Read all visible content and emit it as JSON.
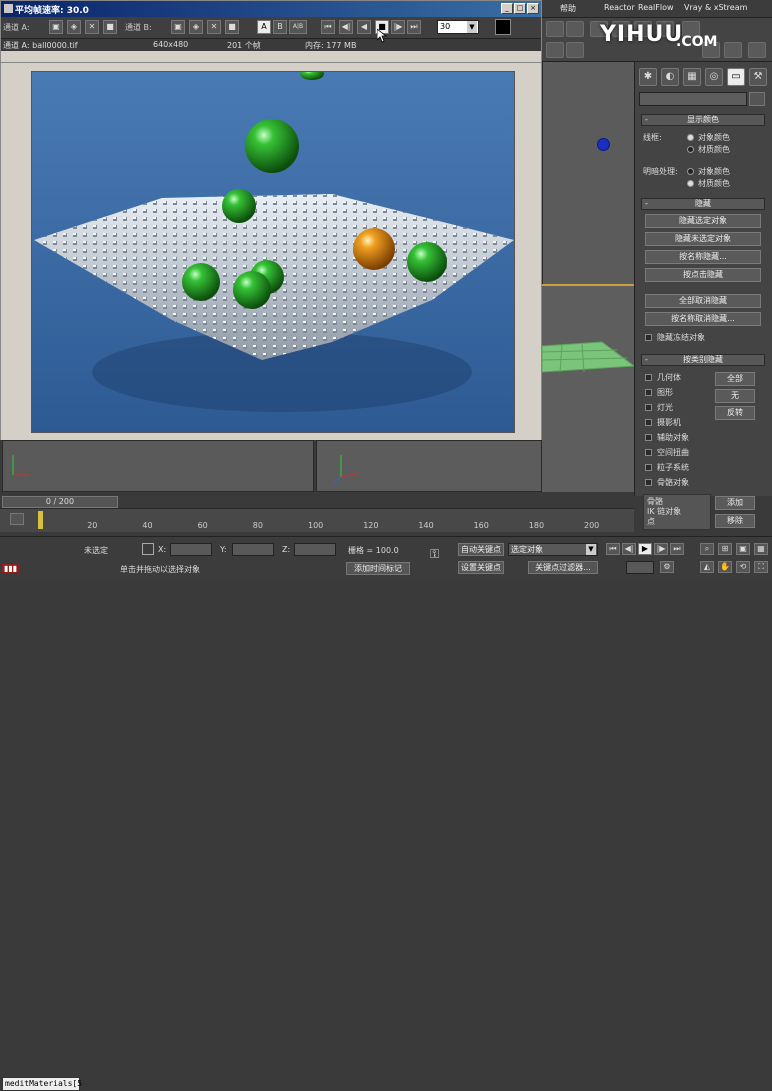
{
  "frame_buffer": {
    "title": "平均帧速率: 30.0",
    "channel_a_label": "通道 A:",
    "channel_b_label": "通道 B:",
    "frame_input_value": "30",
    "info": {
      "channel": "通道 A: ball0000.tif",
      "resolution": "640x480",
      "frame": "201 个帧",
      "memory": "内存: 177 MB"
    },
    "toolbar_letters": [
      "A",
      "B",
      "A|B"
    ]
  },
  "menubar": {
    "help": "帮助",
    "extra1": "Reactor",
    "extra2": "RealFlow",
    "extra3": "Vray & xStream"
  },
  "watermark": {
    "brand": "YIHUU",
    "domain": ".COM"
  },
  "command_panel": {
    "display_color": {
      "header": "显示颜色",
      "wireframe_label": "线框:",
      "shaded_label": "明暗处理:",
      "object_color": "对象颜色",
      "material_color": "材质颜色"
    },
    "hide": {
      "header": "隐藏",
      "hide_selected": "隐藏选定对象",
      "hide_unselected": "隐藏未选定对象",
      "hide_by_name": "按名称隐藏...",
      "hide_by_hit": "按点击隐藏",
      "unhide_all": "全部取消隐藏",
      "unhide_by_name": "按名称取消隐藏...",
      "hide_frozen": "隐藏冻结对象"
    },
    "hide_by_category": {
      "header": "按类别隐藏",
      "items": [
        "几何体",
        "图形",
        "灯光",
        "摄影机",
        "辅助对象",
        "空间扭曲",
        "粒子系统",
        "骨骼对象"
      ],
      "all": "全部",
      "none": "无",
      "invert": "反转",
      "bone_label": "骨骼",
      "ik_chain": "IK 链对象",
      "point": "点",
      "add": "添加",
      "remove": "移除"
    }
  },
  "timeline": {
    "slider_label": "0 / 200",
    "ticks": [
      "20",
      "40",
      "60",
      "80",
      "100",
      "120",
      "140",
      "160",
      "180",
      "200"
    ]
  },
  "statusbar": {
    "listener": "meditMaterials[5",
    "none_selected": "未选定",
    "hint": "单击并拖动以选择对象",
    "x_label": "X:",
    "y_label": "Y:",
    "z_label": "Z:",
    "grid": "栅格 = 100.0",
    "add_time_tag": "添加时间标记",
    "auto_key": "自动关键点",
    "set_key": "设置关键点",
    "selected_object": "选定对象",
    "key_filters": "关键点过滤器..."
  },
  "colors": {
    "render_bg": "#3e6fa8",
    "sphere_green": "#2fae2f",
    "sphere_orange": "#e08a10",
    "titlebar": "#0a246a"
  }
}
